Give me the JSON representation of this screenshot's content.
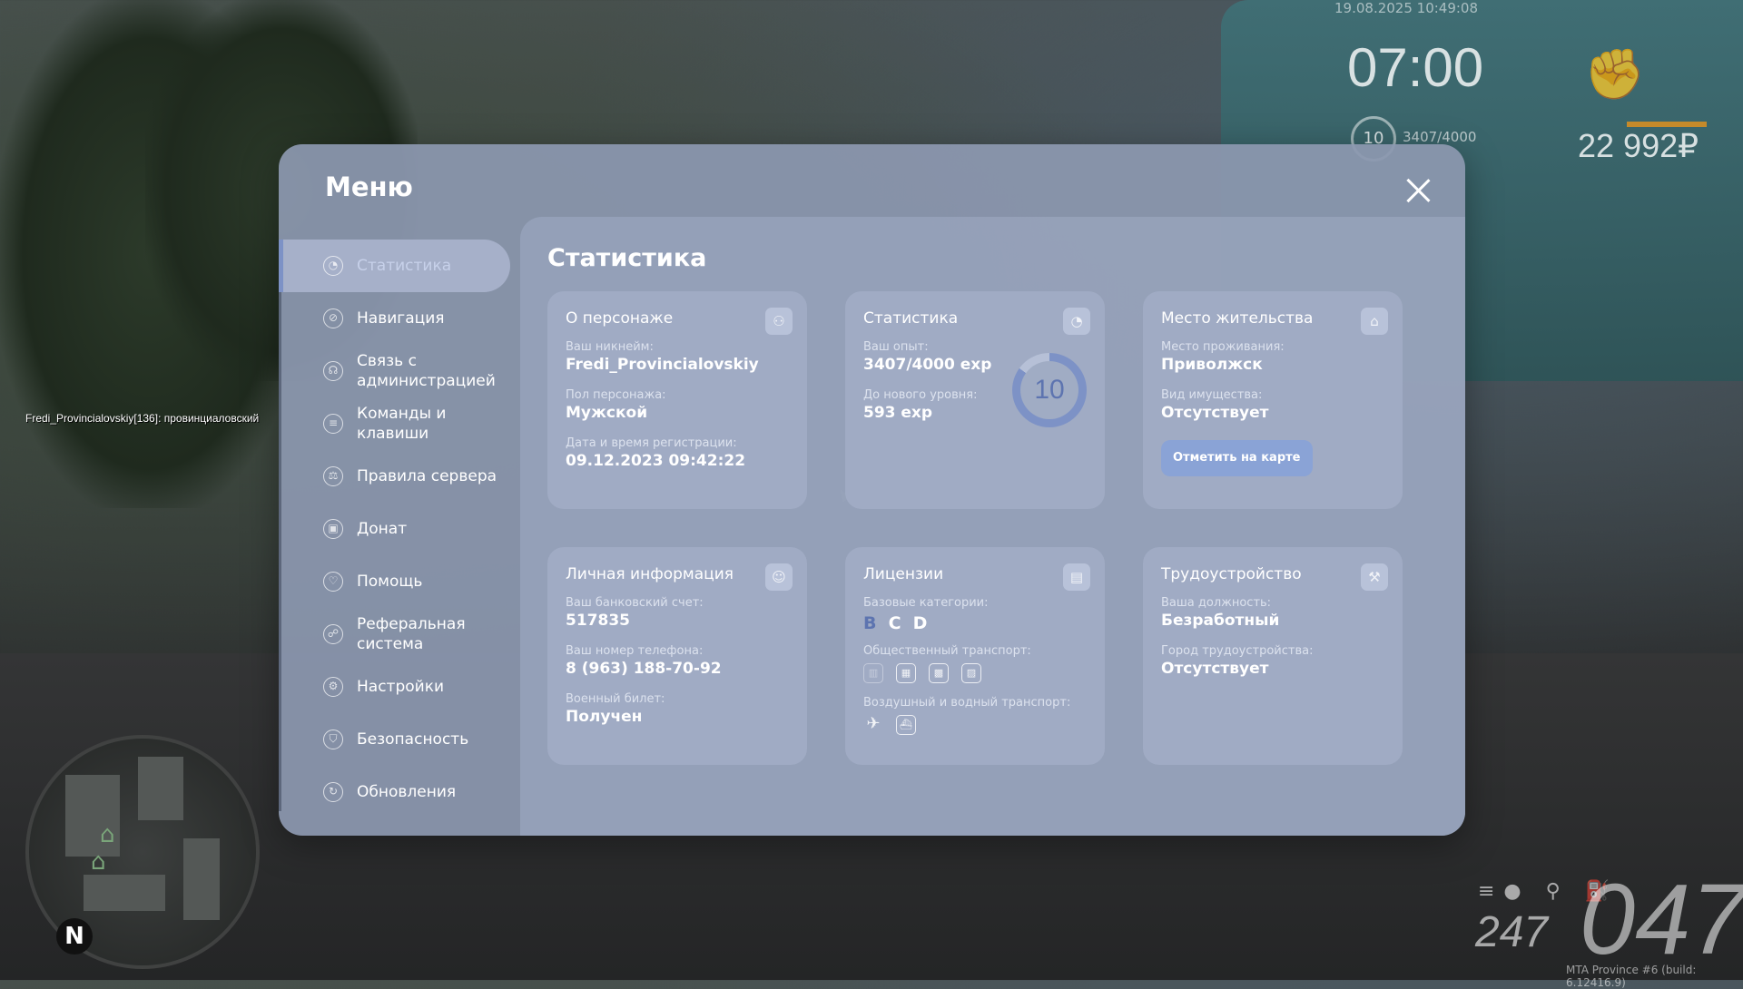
{
  "hud": {
    "date": "19.08.2025 10:49:08",
    "time": "07:00",
    "level": "10",
    "exp": "3407/4000",
    "money": "22 992₽",
    "speed": "047",
    "fuel": "247",
    "build": "MTA Province #6 (build: 6.12416.9)",
    "nametag": "Fredi_Provincialovskiy[136]: провинциаловский",
    "compass": "N"
  },
  "menu": {
    "title": "Меню",
    "close_icon": "close-icon"
  },
  "sidebar": {
    "items": [
      {
        "label": "Статистика",
        "icon": "pie-chart-icon",
        "glyph": "◔"
      },
      {
        "label": "Навигация",
        "icon": "compass-icon",
        "glyph": "⊘"
      },
      {
        "label": "Связь с администрацией",
        "icon": "headset-icon",
        "glyph": "☊"
      },
      {
        "label": "Команды и клавиши",
        "icon": "document-icon",
        "glyph": "≡"
      },
      {
        "label": "Правила сервера",
        "icon": "scales-icon",
        "glyph": "⚖"
      },
      {
        "label": "Донат",
        "icon": "wallet-icon",
        "glyph": "▣"
      },
      {
        "label": "Помощь",
        "icon": "heart-hand-icon",
        "glyph": "♡"
      },
      {
        "label": "Реферальная система",
        "icon": "people-icon",
        "glyph": "☍"
      },
      {
        "label": "Настройки",
        "icon": "gear-icon",
        "glyph": "⚙"
      },
      {
        "label": "Безопасность",
        "icon": "shield-icon",
        "glyph": "⛉"
      },
      {
        "label": "Обновления",
        "icon": "refresh-icon",
        "glyph": "↻"
      }
    ]
  },
  "content": {
    "title": "Статистика",
    "character": {
      "title": "О персонаже",
      "icon": "user-icon",
      "nick_label": "Ваш никнейм:",
      "nick": "Fredi_Provincialovskiy",
      "gender_label": "Пол персонажа:",
      "gender": "Мужской",
      "reg_label": "Дата и время регистрации:",
      "reg": "09.12.2023 09:42:22"
    },
    "stats": {
      "title": "Статистика",
      "icon": "pie-chart-icon",
      "exp_label": "Ваш опыт:",
      "exp": "3407/4000 exp",
      "next_label": "До нового уровня:",
      "next": "593 exp",
      "level": "10",
      "level_progress": 0.85
    },
    "residence": {
      "title": "Место жительства",
      "icon": "home-icon",
      "place_label": "Место проживания:",
      "place": "Приволжск",
      "property_label": "Вид имущества:",
      "property": "Отсутствует",
      "map_button": "Отметить на карте"
    },
    "personal": {
      "title": "Личная информация",
      "icon": "user-circle-icon",
      "bank_label": "Ваш банковский счет:",
      "bank": "517835",
      "phone_label": "Ваш номер телефона:",
      "phone": "8 (963) 188-70-92",
      "military_label": "Военный билет:",
      "military": "Получен"
    },
    "licenses": {
      "title": "Лицензии",
      "icon": "document-icon",
      "base_label": "Базовые категории:",
      "categories": [
        {
          "letter": "B",
          "active": true
        },
        {
          "letter": "C",
          "active": false
        },
        {
          "letter": "D",
          "active": false
        }
      ],
      "public_label": "Общественный транспорт:",
      "public_icons": [
        "trolleybus-icon",
        "bus-icon",
        "tram-icon",
        "train-icon"
      ],
      "air_label": "Воздушный и водный транспорт:",
      "air_icons": [
        "plane-icon",
        "ship-icon"
      ]
    },
    "employment": {
      "title": "Трудоустройство",
      "icon": "hammer-icon",
      "position_label": "Ваша должность:",
      "position": "Безработный",
      "city_label": "Город трудоустройства:",
      "city": "Отсутствует"
    }
  }
}
